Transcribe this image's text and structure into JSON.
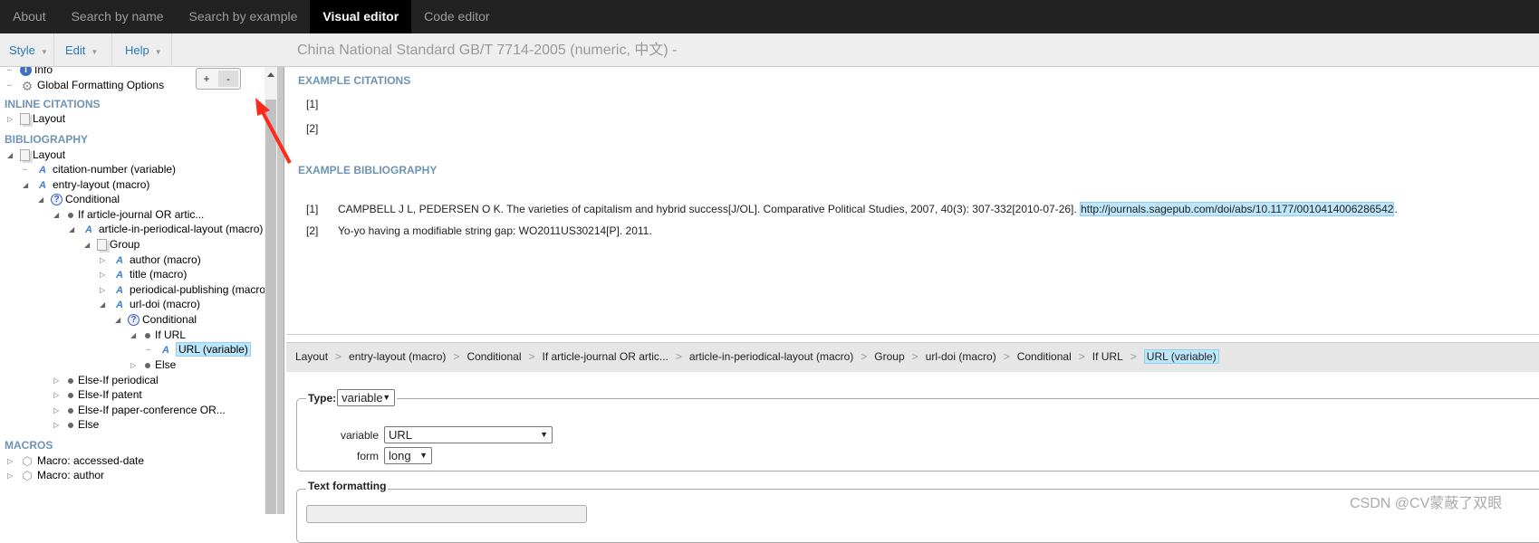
{
  "nav": {
    "tabs": [
      {
        "label": "About",
        "active": false
      },
      {
        "label": "Search by name",
        "active": false
      },
      {
        "label": "Search by example",
        "active": false
      },
      {
        "label": "Visual editor",
        "active": true
      },
      {
        "label": "Code editor",
        "active": false
      }
    ]
  },
  "toolbar": {
    "menus": [
      "Style",
      "Edit",
      "Help"
    ],
    "style_title": "China National Standard GB/T 7714-2005 (numeric, 中文) -"
  },
  "tree_controls": {
    "expand": "+",
    "collapse": "-"
  },
  "tree": {
    "sections": {
      "inline": "INLINE CITATIONS",
      "bibliography": "BIBLIOGRAPHY",
      "macros": "MACROS"
    },
    "items": [
      {
        "label": "Info",
        "icon": "info-icon",
        "level": 0,
        "toggle": "none"
      },
      {
        "label": "Global Formatting Options",
        "icon": "gear-icon",
        "level": 0,
        "toggle": "none"
      },
      {
        "label": "Layout",
        "icon": "layout-icon",
        "level": 0,
        "toggle": "collapsed"
      },
      {
        "label": "Layout",
        "icon": "layout-icon",
        "level": 0,
        "toggle": "expanded"
      },
      {
        "label": "citation-number (variable)",
        "icon": "text-variable-icon",
        "level": 1,
        "toggle": "none"
      },
      {
        "label": "entry-layout (macro)",
        "icon": "text-variable-icon",
        "level": 1,
        "toggle": "expanded"
      },
      {
        "label": "Conditional",
        "icon": "conditional-icon",
        "level": 2,
        "toggle": "expanded"
      },
      {
        "label": "If article-journal OR artic...",
        "icon": "bullet-icon",
        "level": 3,
        "toggle": "expanded"
      },
      {
        "label": "article-in-periodical-layout (macro)",
        "icon": "text-variable-icon",
        "level": 4,
        "toggle": "expanded"
      },
      {
        "label": "Group",
        "icon": "layout-icon",
        "level": 5,
        "toggle": "expanded"
      },
      {
        "label": "author (macro)",
        "icon": "text-variable-icon",
        "level": 6,
        "toggle": "collapsed"
      },
      {
        "label": "title (macro)",
        "icon": "text-variable-icon",
        "level": 6,
        "toggle": "collapsed"
      },
      {
        "label": "periodical-publishing (macro)",
        "icon": "text-variable-icon",
        "level": 6,
        "toggle": "collapsed"
      },
      {
        "label": "url-doi (macro)",
        "icon": "text-variable-icon",
        "level": 6,
        "toggle": "expanded"
      },
      {
        "label": "Conditional",
        "icon": "conditional-icon",
        "level": 7,
        "toggle": "expanded"
      },
      {
        "label": "If URL",
        "icon": "bullet-icon",
        "level": 8,
        "toggle": "expanded"
      },
      {
        "label": "URL (variable)",
        "icon": "text-variable-icon",
        "level": 9,
        "toggle": "none",
        "selected": true
      },
      {
        "label": "Else",
        "icon": "bullet-icon",
        "level": 8,
        "toggle": "collapsed"
      },
      {
        "label": "Else-If periodical",
        "icon": "bullet-icon",
        "level": 3,
        "toggle": "collapsed"
      },
      {
        "label": "Else-If patent",
        "icon": "bullet-icon",
        "level": 3,
        "toggle": "collapsed"
      },
      {
        "label": "Else-If paper-conference OR...",
        "icon": "bullet-icon",
        "level": 3,
        "toggle": "collapsed"
      },
      {
        "label": "Else",
        "icon": "bullet-icon",
        "level": 3,
        "toggle": "collapsed"
      },
      {
        "label": "Macro: accessed-date",
        "icon": "macro-icon",
        "level": 0,
        "toggle": "collapsed"
      },
      {
        "label": "Macro: author",
        "icon": "macro-icon",
        "level": 0,
        "toggle": "collapsed"
      }
    ]
  },
  "preview": {
    "citations_heading": "EXAMPLE CITATIONS",
    "citations": [
      "[1]",
      "[2]"
    ],
    "bibliography_heading": "EXAMPLE BIBLIOGRAPHY",
    "bibliography": [
      {
        "num": "[1]",
        "text": "CAMPBELL J L, PEDERSEN O K. The varieties of capitalism and hybrid success[J/OL]. Comparative Political Studies, 2007, 40(3): 307-332[2010-07-26]. ",
        "link": "http://journals.sagepub.com/doi/abs/10.1177/0010414006286542",
        "tail": "."
      },
      {
        "num": "[2]",
        "text": "Yo-yo having a modifiable string gap: WO2011US30214[P]. 2011.",
        "link": "",
        "tail": ""
      }
    ]
  },
  "breadcrumb": [
    "Layout",
    "entry-layout (macro)",
    "Conditional",
    "If article-journal OR artic...",
    "article-in-periodical-layout (macro)",
    "Group",
    "url-doi (macro)",
    "Conditional",
    "If URL",
    "URL (variable)"
  ],
  "breadcrumb_separator": ">",
  "form": {
    "type_label": "Type:",
    "type_value": "variable",
    "variable_label": "variable",
    "variable_value": "URL",
    "form_label": "form",
    "form_value": "long",
    "text_formatting_label": "Text formatting"
  },
  "watermark": "CSDN @CV蒙蔽了双眼",
  "colors": {
    "accent": "#2a7ab8",
    "section_heading": "#6f93b3",
    "selection": "#bde6fb",
    "annotation_arrow": "#ff2a1a"
  }
}
